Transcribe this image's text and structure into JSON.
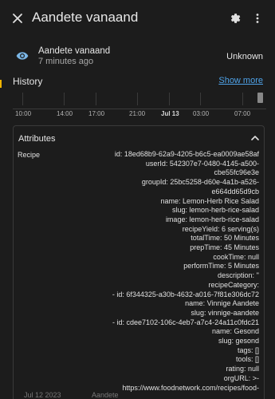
{
  "header": {
    "title": "Aandete vanaand",
    "close_icon": "close-icon",
    "settings_icon": "gear-icon",
    "more_icon": "more-vertical-icon"
  },
  "state": {
    "icon": "eye-icon",
    "entity_name": "Aandete vanaand",
    "last_changed": "7 minutes ago",
    "value": "Unknown"
  },
  "history": {
    "title": "History",
    "show_more": "Show more",
    "axis_labels": [
      "10:00",
      "14:00",
      "17:00",
      "21:00",
      "Jul 13",
      "03:00",
      "07:00"
    ]
  },
  "attributes": {
    "title": "Attributes",
    "key": "Recipe",
    "lines": [
      "id: 18ed68b9-62a9-4205-b6c5-ea0009ae58af",
      "userId: 542307e7-0480-4145-a500-",
      "cbe55fc96e3e",
      "groupId: 25bc5258-d60e-4a1b-a526-",
      "e664dd65d9cb",
      "name: Lemon-Herb Rice Salad",
      "slug: lemon-herb-rice-salad",
      "image: lemon-herb-rice-salad",
      "recipeYield: 6 serving(s)",
      "totalTime: 50 Minutes",
      "prepTime: 45 Minutes",
      "cookTime: null",
      "performTime: 5 Minutes",
      "description: ''",
      "recipeCategory:",
      "- id: 6f344325-a30b-4632-a016-7f81e306dc72",
      "name: Vinnige Aandete",
      "slug: vinnige-aandete",
      "- id: cdee7102-106c-4eb7-a7c4-24a11c0fdc21",
      "name: Gesond",
      "slug: gesond",
      "tags: []",
      "tools: []",
      "rating: null",
      "orgURL: >-",
      "https://www.foodnetwork.com/recipes/food-"
    ]
  },
  "background": {
    "left_text": "Jul 12 2023",
    "right_text": "Aandete"
  },
  "colors": {
    "accent": "#4ea2e8",
    "history_marker": "#f0b400",
    "dialog_bg": "#1c1c1c"
  }
}
